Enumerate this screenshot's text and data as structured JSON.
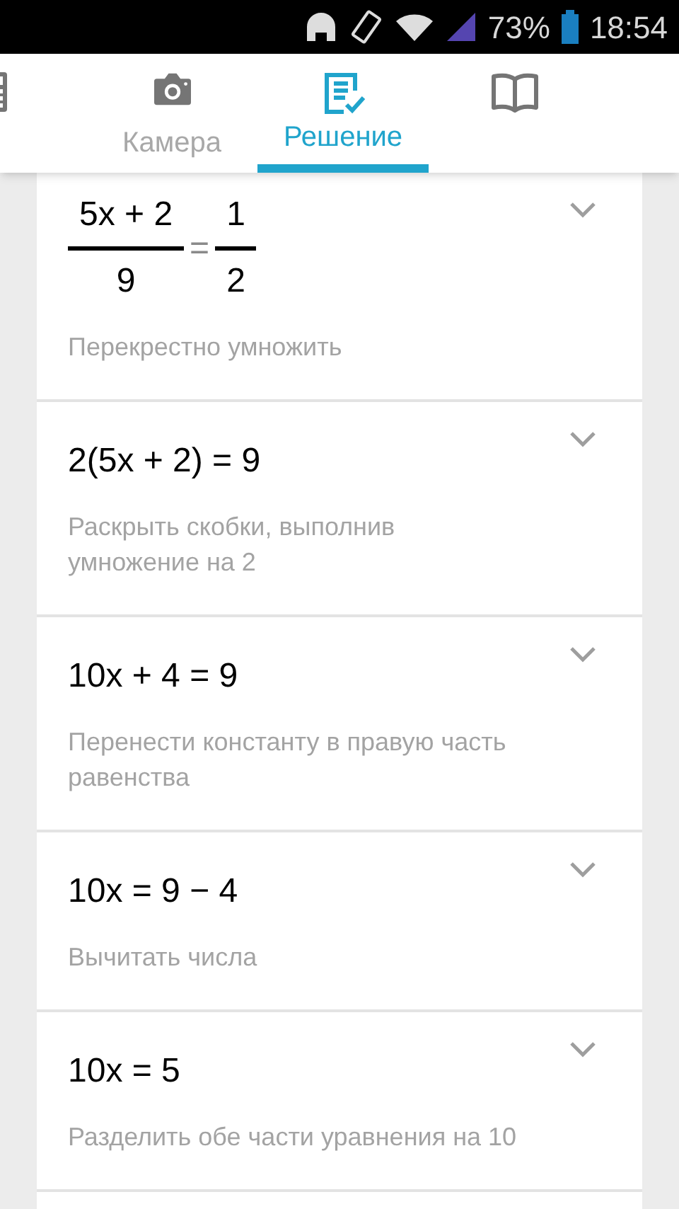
{
  "status_bar": {
    "battery": "73%",
    "time": "18:54"
  },
  "tabs": [
    {
      "kind": "calculator",
      "selected": false
    },
    {
      "kind": "camera",
      "label": "Камера",
      "selected": false
    },
    {
      "kind": "solution",
      "label": "Решение",
      "selected": true
    },
    {
      "kind": "book",
      "selected": false
    }
  ],
  "steps": [
    {
      "kind": "fraction",
      "numerator": "5x + 2",
      "denominator": "9",
      "operator": "=",
      "right_numerator": "1",
      "right_denominator": "2",
      "description": "Перекрестно умножить"
    },
    {
      "kind": "line",
      "expression": "2(5x + 2) = 9",
      "description": "Раскрыть скобки, выполнив умножение на 2"
    },
    {
      "kind": "line",
      "expression": "10x + 4 = 9",
      "description": "Перенести константу в правую часть равенства"
    },
    {
      "kind": "line",
      "expression": "10x = 9 − 4",
      "description": "Вычитать числа"
    },
    {
      "kind": "line",
      "expression": "10x = 5",
      "description": "Разделить обе части уравнения на 10"
    }
  ]
}
